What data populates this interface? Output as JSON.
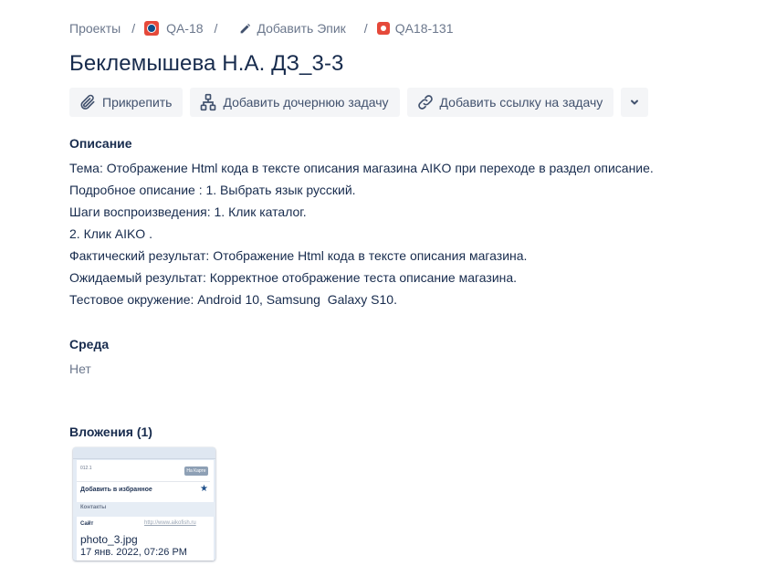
{
  "breadcrumbs": {
    "projects": "Проекты",
    "separator": "/",
    "project_key": "QA-18",
    "add_epic": "Добавить Эпик",
    "issue_key": "QA18-131"
  },
  "issue": {
    "title": "Беклемышева Н.А. ДЗ_3-3"
  },
  "toolbar": {
    "attach_label": "Прикрепить",
    "add_child_label": "Добавить дочернюю задачу",
    "add_link_label": "Добавить ссылку на задачу"
  },
  "description": {
    "label": "Описание",
    "lines": [
      "Тема: Отображение Html кода в тексте описания магазина AIKO при переходе в раздел описание.",
      "Подробное описание : 1. Выбрать язык русский.",
      "Шаги воспроизведения: 1. Клик каталог.",
      "2. Клик AIKO .",
      "Фактический результат: Отображение Html кода в тексте описания магазина.",
      "Ожидаемый результат: Корректное отображение теста описание магазина.",
      "Тестовое окружение: Android 10, Samsung  Galaxy S10."
    ]
  },
  "environment": {
    "label": "Среда",
    "value": "Нет"
  },
  "attachments": {
    "label": "Вложения (1)",
    "items": [
      {
        "filename": "photo_3.jpg",
        "date": "17 янв. 2022, 07:26 PM",
        "thumb": {
          "top_text": "012.1",
          "map_button": "На Карте",
          "favorites": "Добавить в избранное",
          "contacts": "Контакты",
          "site_label": "Сайт",
          "site_url": "http://www.aikofish.ru"
        }
      }
    ]
  },
  "colors": {
    "text": "#172b4d",
    "muted": "#6b778c",
    "button_bg": "#f4f5f7",
    "icon_red": "#e5493a"
  },
  "icons": {
    "project": "project-avatar-icon",
    "edit": "pencil-icon",
    "issue_type": "bug-icon",
    "attach": "paperclip-icon",
    "child": "hierarchy-icon",
    "link": "link-icon",
    "more": "chevron-down-icon"
  }
}
